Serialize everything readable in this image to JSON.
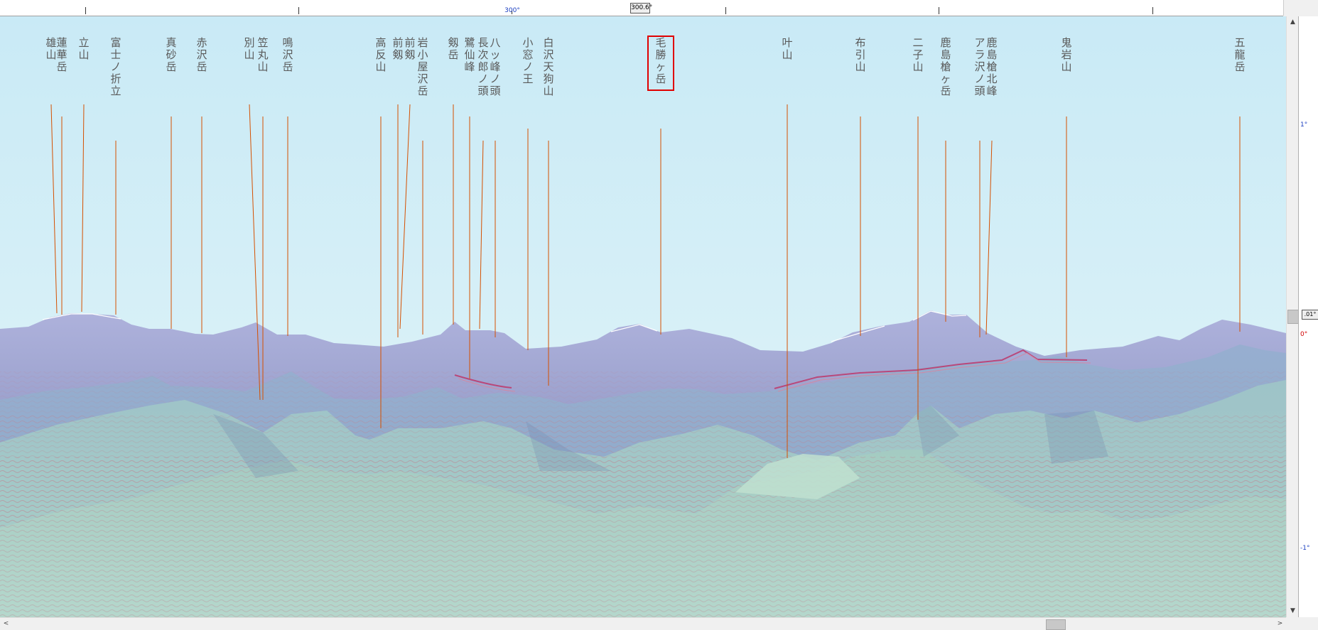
{
  "ruler": {
    "center_degree_label": "300°",
    "direction_readout": "300.6°"
  },
  "elevation_ruler": {
    "upper_label": "1°",
    "zero_label": "0°",
    "lower_label": "-1°",
    "readout": ".01°"
  },
  "scroll_arrows": {
    "up": "▲",
    "down": "▼",
    "left": "<",
    "right": ">"
  },
  "colors": {
    "sky_top": "#c9eaf6",
    "sky_horizon": "#e0f3f8",
    "far_range": "#a6abd6",
    "leader_line": "#d55000",
    "selection_box": "#e00000",
    "track": "#b9487a",
    "label_text": "#5a5a5a"
  },
  "peaks": [
    {
      "name": "雄山"
    },
    {
      "name": "蓮華岳"
    },
    {
      "name": "立山"
    },
    {
      "name": "富士ノ折立"
    },
    {
      "name": "真砂岳"
    },
    {
      "name": "赤沢岳"
    },
    {
      "name": "別山"
    },
    {
      "name": "笠丸山"
    },
    {
      "name": "鳴沢岳"
    },
    {
      "name": "高反山"
    },
    {
      "name": "前剱"
    },
    {
      "name": "前剱"
    },
    {
      "name": "岩小屋沢岳"
    },
    {
      "name": "剱岳"
    },
    {
      "name": "鷺仙峰"
    },
    {
      "name": "長次郎ノ頭"
    },
    {
      "name": "八ッ峰ノ頭"
    },
    {
      "name": "小窓ノ王"
    },
    {
      "name": "白沢天狗山"
    },
    {
      "name": "毛勝ヶ岳",
      "selected": true
    },
    {
      "name": "叶山"
    },
    {
      "name": "布引山"
    },
    {
      "name": "二子山"
    },
    {
      "name": "鹿島槍ヶ岳"
    },
    {
      "name": "アラ沢ノ頭"
    },
    {
      "name": "鹿島槍北峰"
    },
    {
      "name": "鬼岩山"
    },
    {
      "name": "五龍岳"
    }
  ]
}
